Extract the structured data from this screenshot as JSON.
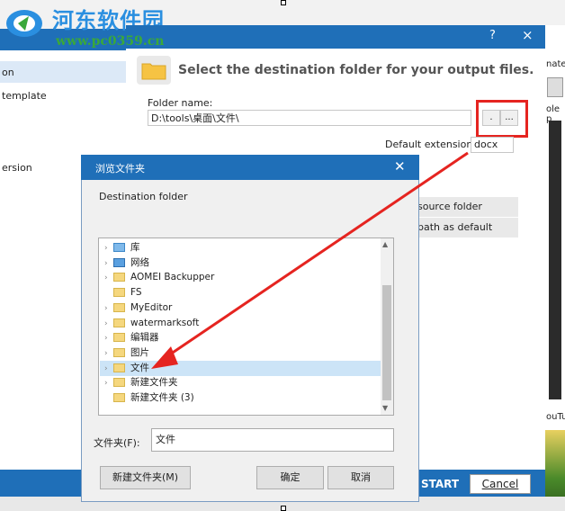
{
  "watermark": {
    "site_name": "河东软件园",
    "url": "www.pc0359.cn"
  },
  "left_panel": {
    "items": [
      "on",
      "template",
      "ersion"
    ]
  },
  "main_window": {
    "help_glyph": "?",
    "close_glyph": "×",
    "headline": "Select the destination folder for your output files.",
    "folder_name_label": "Folder name:",
    "folder_name_value": "D:\\tools\\桌面\\文件\\",
    "small_btn_1": ".",
    "small_btn_2": "...",
    "default_extension_label": "Default extension:",
    "default_extension_value": "docx",
    "side_buttons": [
      "source folder",
      "path as default"
    ],
    "start_label": "START",
    "cancel_label": "Cancel"
  },
  "right_panel": {
    "text_1": "nate",
    "text_2": "ole p",
    "text_3": "ouTu"
  },
  "browse_dialog": {
    "title": "浏览文件夹",
    "close_glyph": "✕",
    "destination_label": "Destination folder",
    "tree": [
      {
        "label": "库",
        "icon": "library-icon",
        "has_children": true
      },
      {
        "label": "网络",
        "icon": "network-icon",
        "has_children": true
      },
      {
        "label": "AOMEI Backupper",
        "icon": "folder-icon",
        "has_children": true
      },
      {
        "label": "FS",
        "icon": "folder-icon",
        "has_children": false
      },
      {
        "label": "MyEditor",
        "icon": "folder-icon",
        "has_children": true
      },
      {
        "label": "watermarksoft",
        "icon": "folder-icon",
        "has_children": true
      },
      {
        "label": "编辑器",
        "icon": "folder-icon",
        "has_children": true
      },
      {
        "label": "图片",
        "icon": "folder-icon",
        "has_children": true
      },
      {
        "label": "文件",
        "icon": "folder-icon",
        "has_children": true,
        "selected": true
      },
      {
        "label": "新建文件夹",
        "icon": "folder-icon",
        "has_children": true
      },
      {
        "label": "新建文件夹 (3)",
        "icon": "folder-icon",
        "has_children": false
      }
    ],
    "folder_label": "文件夹(F):",
    "folder_value": "文件",
    "new_folder_button": "新建文件夹(M)",
    "ok_button": "确定",
    "cancel_button": "取消"
  },
  "colors": {
    "accent": "#1f6fb8",
    "highlight": "#e52420",
    "selection": "#cce4f7"
  }
}
